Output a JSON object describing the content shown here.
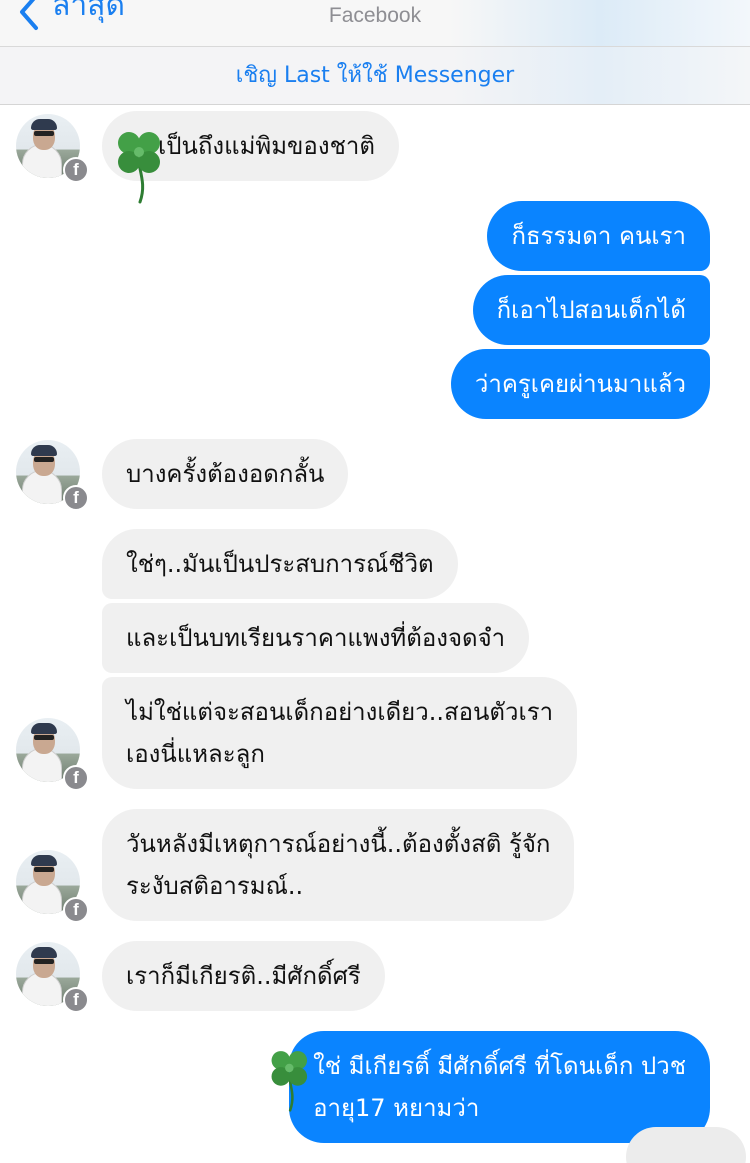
{
  "header": {
    "back_label": "ล่าสุด",
    "title": "Facebook"
  },
  "invite_banner": "เชิญ Last ให้ใช้ Messenger",
  "messages": [
    {
      "from": "them",
      "text": "เป็นถึงแม่พิมของชาติ"
    },
    {
      "from": "me",
      "text": "ก็ธรรมดา คนเรา"
    },
    {
      "from": "me",
      "text": "ก็เอาไปสอนเด็กได้"
    },
    {
      "from": "me",
      "text": "ว่าครูเคยผ่านมาแล้ว"
    },
    {
      "from": "them",
      "text": "บางครั้งต้องอดกลั้น"
    },
    {
      "from": "them",
      "text": "ใช่ๆ..มันเป็นประสบการณ์ชีวิต"
    },
    {
      "from": "them",
      "text": "และเป็นบทเรียนราคาแพงที่ต้องจดจำ"
    },
    {
      "from": "them",
      "lines": [
        "ไม่ใช่แต่จะสอนเด็กอย่างเดียว..สอนตัวเรา",
        "เองนี่แหละลูก"
      ]
    },
    {
      "from": "them",
      "lines": [
        "วันหลังมีเหตุการณ์อย่างนี้..ต้องตั้งสติ รู้จัก",
        "ระงับสติอารมณ์.."
      ]
    },
    {
      "from": "them",
      "text": "เราก็มีเกียรติ..มีศักดิ์ศรี"
    },
    {
      "from": "me",
      "lines": [
        "ใช่ มีเกียรติ์ มีศักดิ์ศรี ที่โดนเด็ก ปวช",
        "อายุ17 หยามว่า"
      ]
    }
  ],
  "icons": {
    "platform_badge": "facebook-badge-icon",
    "sticker": "four-leaf-clover-icon"
  },
  "colors": {
    "accent": "#0a84ff",
    "incoming_bubble": "#f0f0f0",
    "link": "#1a7ff0"
  }
}
